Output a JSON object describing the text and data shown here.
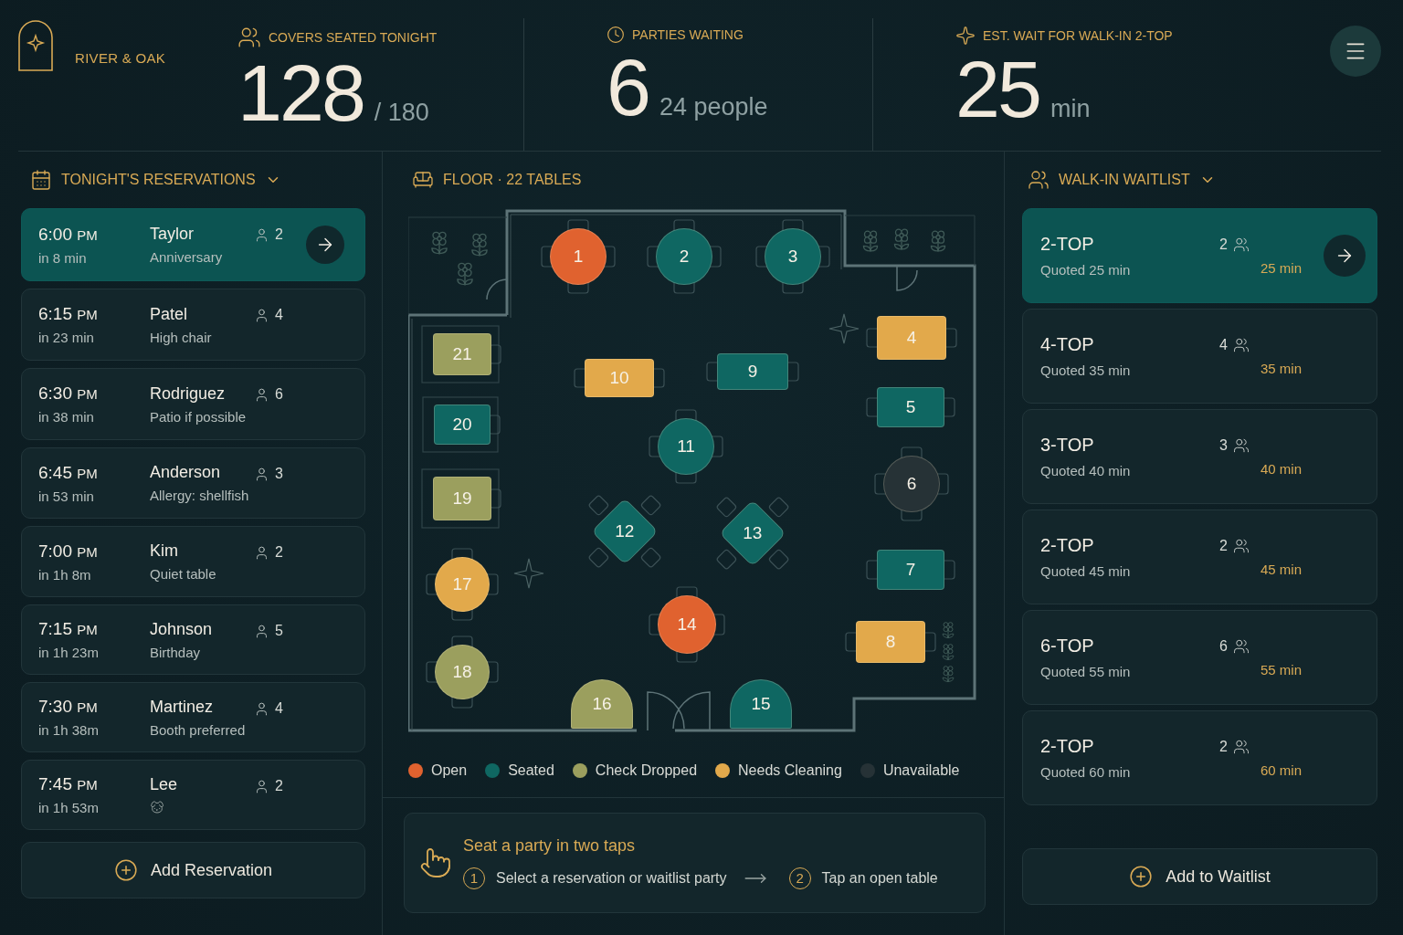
{
  "brand": {
    "name": "RIVER & OAK"
  },
  "stats": [
    {
      "label": "COVERS SEATED TONIGHT",
      "value": "128",
      "suffix": "/ 180"
    },
    {
      "label": "PARTIES WAITING",
      "value": "6",
      "suffix": "24 people"
    },
    {
      "label": "EST. WAIT FOR WALK-IN 2-TOP",
      "value": "25",
      "suffix": "min"
    }
  ],
  "reservations": {
    "title": "TONIGHT'S RESERVATIONS",
    "items": [
      {
        "time": "6:00",
        "period": "PM",
        "eta": "in 8 min",
        "name": "Taylor",
        "note": "Anniversary",
        "party": "2",
        "pet": false,
        "selected": true
      },
      {
        "time": "6:15",
        "period": "PM",
        "eta": "in 23 min",
        "name": "Patel",
        "note": "High chair",
        "party": "4",
        "pet": false,
        "selected": false
      },
      {
        "time": "6:30",
        "period": "PM",
        "eta": "in 38 min",
        "name": "Rodriguez",
        "note": "Patio if possible",
        "party": "6",
        "pet": false,
        "selected": false
      },
      {
        "time": "6:45",
        "period": "PM",
        "eta": "in 53 min",
        "name": "Anderson",
        "note": "Allergy: shellfish",
        "party": "3",
        "pet": false,
        "selected": false
      },
      {
        "time": "7:00",
        "period": "PM",
        "eta": "in 1h 8m",
        "name": "Kim",
        "note": "Quiet table",
        "party": "2",
        "pet": false,
        "selected": false
      },
      {
        "time": "7:15",
        "period": "PM",
        "eta": "in 1h 23m",
        "name": "Johnson",
        "note": "Birthday",
        "party": "5",
        "pet": false,
        "selected": false
      },
      {
        "time": "7:30",
        "period": "PM",
        "eta": "in 1h 38m",
        "name": "Martinez",
        "note": "Booth preferred",
        "party": "4",
        "pet": false,
        "selected": false
      },
      {
        "time": "7:45",
        "period": "PM",
        "eta": "in 1h 53m",
        "name": "Lee",
        "party": "2",
        "pet": true,
        "selected": false
      }
    ],
    "add_button": "Add Reservation"
  },
  "floor": {
    "title": "FLOOR · 22 TABLES",
    "tables": [
      {
        "label": "1",
        "kind": "round",
        "color": "#e0622f"
      },
      {
        "label": "2",
        "kind": "round",
        "color": "#0f6762"
      },
      {
        "label": "3",
        "kind": "round",
        "color": "#0f6762"
      },
      {
        "label": "4",
        "kind": "rect",
        "color": "#e2a94b"
      },
      {
        "label": "21",
        "kind": "booth",
        "color": "#9b9f5e"
      },
      {
        "label": "10",
        "kind": "rect",
        "color": "#e2a94b"
      },
      {
        "label": "9",
        "kind": "rect",
        "color": "#0f6762"
      },
      {
        "label": "5",
        "kind": "rect",
        "color": "#0f6762"
      },
      {
        "label": "20",
        "kind": "booth",
        "color": "#0f6762"
      },
      {
        "label": "11",
        "kind": "round",
        "color": "#0f6762"
      },
      {
        "label": "6",
        "kind": "round",
        "color": "#263236"
      },
      {
        "label": "19",
        "kind": "booth",
        "color": "#9b9f5e"
      },
      {
        "label": "12",
        "kind": "diamond",
        "color": "#0f6762"
      },
      {
        "label": "13",
        "kind": "diamond",
        "color": "#0f6762"
      },
      {
        "label": "7",
        "kind": "rect",
        "color": "#0f6762"
      },
      {
        "label": "17",
        "kind": "round",
        "color": "#e2a94b"
      },
      {
        "label": "14",
        "kind": "round",
        "color": "#e0622f"
      },
      {
        "label": "8",
        "kind": "rect",
        "color": "#e2a94b"
      },
      {
        "label": "18",
        "kind": "round",
        "color": "#9b9f5e"
      },
      {
        "label": "16",
        "kind": "half",
        "color": "#9b9f5e"
      },
      {
        "label": "15",
        "kind": "half",
        "color": "#0f6762"
      }
    ],
    "legend": [
      {
        "label": "Open",
        "color": "#e0622f"
      },
      {
        "label": "Seated",
        "color": "#0f6762"
      },
      {
        "label": "Check Dropped",
        "color": "#9b9f5e"
      },
      {
        "label": "Needs Cleaning",
        "color": "#e2a94b"
      },
      {
        "label": "Unavailable",
        "color": "#263236"
      }
    ]
  },
  "tip": {
    "title": "Seat a party in two taps",
    "steps": [
      {
        "number": "1",
        "text": "Select a reservation or waitlist party"
      },
      {
        "number": "2",
        "text": "Tap an open table"
      }
    ]
  },
  "waitlist": {
    "title": "WALK-IN WAITLIST",
    "items": [
      {
        "table": "2-TOP",
        "quoted": "Quoted 25 min",
        "party": "2",
        "wait": "25 min",
        "selected": true
      },
      {
        "table": "4-TOP",
        "quoted": "Quoted 35 min",
        "party": "4",
        "wait": "35 min",
        "selected": false
      },
      {
        "table": "3-TOP",
        "quoted": "Quoted 40 min",
        "party": "3",
        "wait": "40 min",
        "selected": false
      },
      {
        "table": "2-TOP",
        "quoted": "Quoted 45 min",
        "party": "2",
        "wait": "45 min",
        "selected": false
      },
      {
        "table": "6-TOP",
        "quoted": "Quoted 55 min",
        "party": "6",
        "wait": "55 min",
        "selected": false
      },
      {
        "table": "2-TOP",
        "quoted": "Quoted 60 min",
        "party": "2",
        "wait": "60 min",
        "selected": false
      }
    ],
    "add_button": "Add to Waitlist"
  }
}
